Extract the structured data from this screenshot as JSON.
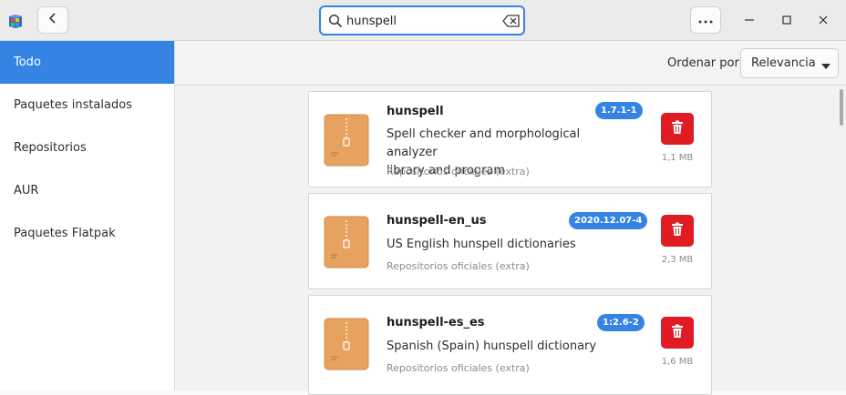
{
  "header": {
    "search_value": "hunspell"
  },
  "sidebar": {
    "items": [
      {
        "label": "Todo"
      },
      {
        "label": "Paquetes instalados"
      },
      {
        "label": "Repositorios"
      },
      {
        "label": "AUR"
      },
      {
        "label": "Paquetes Flatpak"
      }
    ],
    "active_index": 0
  },
  "sortbar": {
    "label": "Ordenar por",
    "selected": "Relevancia"
  },
  "packages": [
    {
      "name": "hunspell",
      "version": "1.7.1-1",
      "description_line1": "Spell checker and morphological analyzer",
      "description_line2": "library and program",
      "repo": "Repositorios oficiales (extra)",
      "size": "1,1 MB"
    },
    {
      "name": "hunspell-en_us",
      "version": "2020.12.07-4",
      "description_line1": "US English hunspell dictionaries",
      "description_line2": "",
      "repo": "Repositorios oficiales (extra)",
      "size": "2,3 MB"
    },
    {
      "name": "hunspell-es_es",
      "version": "1:2.6-2",
      "description_line1": "Spanish (Spain) hunspell dictionary",
      "description_line2": "",
      "repo": "Repositorios oficiales (extra)",
      "size": "1,6 MB"
    }
  ],
  "colors": {
    "accent": "#3584e4",
    "remove": "#e01b24",
    "package_icon": "#e8a25f"
  },
  "icons": [
    "app-logo-icon",
    "back-arrow-icon",
    "search-icon",
    "clear-text-icon",
    "more-menu-icon",
    "minimize-icon",
    "maximize-icon",
    "close-icon",
    "package-archive-icon",
    "trash-icon",
    "chevron-down-icon"
  ]
}
